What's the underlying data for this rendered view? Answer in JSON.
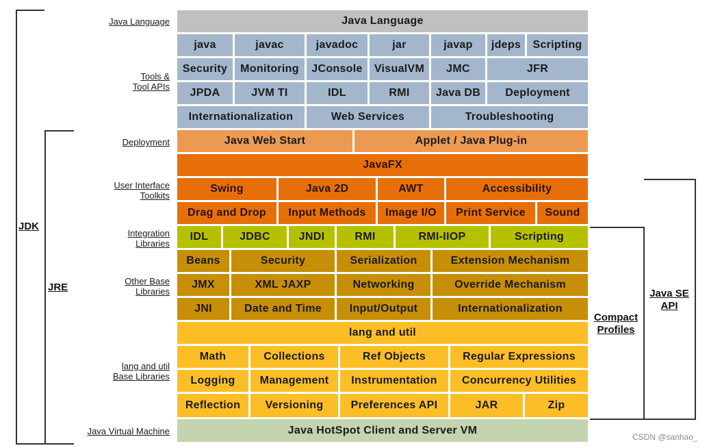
{
  "colors": {
    "language": "#c0c0c0",
    "tools": "#a3b6cc",
    "deployment": "#ec9a52",
    "ui": "#e66f0a",
    "integration": "#b5c100",
    "other_base": "#c78e07",
    "lang_util": "#fcbe27",
    "jvm": "#c3d4ae"
  },
  "left_labels": {
    "java_language": [
      "Java Language"
    ],
    "tools": [
      "Tools &",
      "Tool APIs"
    ],
    "deployment": [
      "Deployment"
    ],
    "ui": [
      "User Interface",
      "Toolkits"
    ],
    "integration": [
      "Integration",
      "Libraries"
    ],
    "other_base": [
      "Other Base",
      "Libraries"
    ],
    "lang_util": [
      "lang and util",
      "Base Libraries"
    ],
    "jvm": [
      "Java Virtual Machine"
    ]
  },
  "brackets": {
    "jdk": "JDK",
    "jre": "JRE",
    "compact": [
      "Compact",
      "Profiles"
    ],
    "javase": [
      "Java SE",
      "API"
    ]
  },
  "rows": [
    {
      "group": "language",
      "cells": [
        "Java Language"
      ]
    },
    {
      "group": "tools",
      "cells": [
        "java",
        "javac",
        "javadoc",
        "jar",
        "javap",
        "jdeps",
        "Scripting"
      ]
    },
    {
      "group": "tools",
      "cells": [
        "Security",
        "Monitoring",
        "JConsole",
        "VisualVM",
        "JMC",
        "JFR"
      ]
    },
    {
      "group": "tools",
      "cells": [
        "JPDA",
        "JVM TI",
        "IDL",
        "RMI",
        "Java DB",
        "Deployment"
      ]
    },
    {
      "group": "tools",
      "cells": [
        "Internationalization",
        "Web Services",
        "Troubleshooting"
      ]
    },
    {
      "group": "deployment",
      "cells": [
        "Java Web Start",
        "Applet / Java Plug-in"
      ]
    },
    {
      "group": "ui",
      "cells": [
        "JavaFX"
      ]
    },
    {
      "group": "ui",
      "cells": [
        "Swing",
        "Java 2D",
        "AWT",
        "Accessibility"
      ]
    },
    {
      "group": "ui",
      "cells": [
        "Drag and Drop",
        "Input Methods",
        "Image I/O",
        "Print Service",
        "Sound"
      ]
    },
    {
      "group": "integration",
      "cells": [
        "IDL",
        "JDBC",
        "JNDI",
        "RMI",
        "RMI-IIOP",
        "Scripting"
      ]
    },
    {
      "group": "other_base",
      "cells": [
        "Beans",
        "Security",
        "Serialization",
        "Extension Mechanism"
      ]
    },
    {
      "group": "other_base",
      "cells": [
        "JMX",
        "XML JAXP",
        "Networking",
        "Override Mechanism"
      ]
    },
    {
      "group": "other_base",
      "cells": [
        "JNI",
        "Date and Time",
        "Input/Output",
        "Internationalization"
      ]
    },
    {
      "group": "lang_util",
      "cells": [
        "lang and util"
      ]
    },
    {
      "group": "lang_util",
      "cells": [
        "Math",
        "Collections",
        "Ref Objects",
        "Regular Expressions"
      ]
    },
    {
      "group": "lang_util",
      "cells": [
        "Logging",
        "Management",
        "Instrumentation",
        "Concurrency Utilities"
      ]
    },
    {
      "group": "lang_util",
      "cells": [
        "Reflection",
        "Versioning",
        "Preferences API",
        "JAR",
        "Zip"
      ]
    },
    {
      "group": "jvm",
      "cells": [
        "Java HotSpot Client and Server VM"
      ]
    }
  ],
  "watermark": "CSDN @sanhao_"
}
